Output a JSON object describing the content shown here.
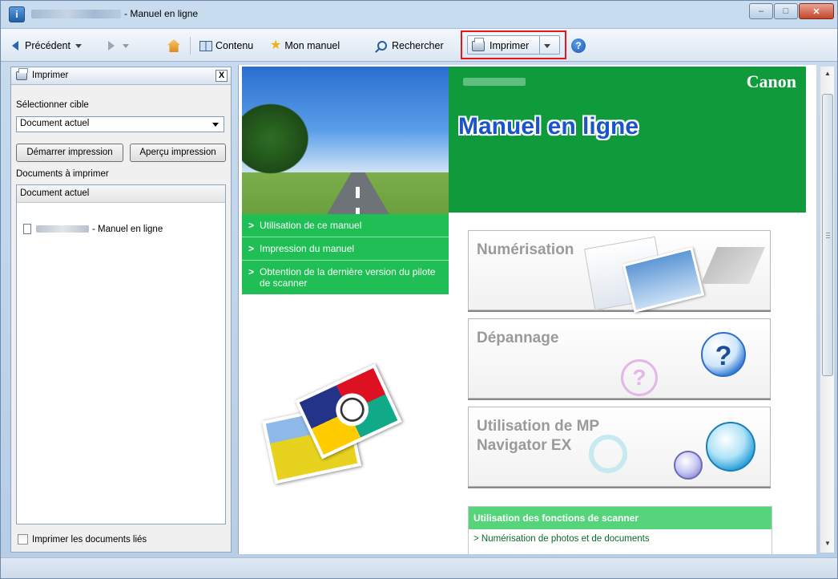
{
  "window": {
    "title_suffix": "- Manuel en ligne",
    "minimize_label": "–",
    "maximize_label": "□",
    "close_label": "✕"
  },
  "toolbar": {
    "back_label": "Précédent",
    "contents_label": "Contenu",
    "my_manual_label": "Mon manuel",
    "search_label": "Rechercher",
    "print_label": "Imprimer",
    "help_label": "?"
  },
  "print_pane": {
    "title": "Imprimer",
    "close_label": "X",
    "select_target_label": "Sélectionner cible",
    "target_value": "Document actuel",
    "start_print_label": "Démarrer impression",
    "print_preview_label": "Aperçu impression",
    "docs_to_print_label": "Documents à imprimer",
    "list_header": "Document actuel",
    "list_item_suffix": "- Manuel en ligne",
    "print_linked_label": "Imprimer les documents liés"
  },
  "content": {
    "brand": "Canon",
    "title": "Manuel en ligne",
    "links": [
      "Utilisation de ce manuel",
      "Impression du manuel",
      "Obtention de la dernière version du pilote de scanner"
    ],
    "cards": [
      "Numérisation",
      "Dépannage",
      "Utilisation de MP Navigator EX"
    ],
    "functions_header": "Utilisation des fonctions de scanner",
    "functions_link": "Numérisation de photos et de documents"
  },
  "colors": {
    "accent_red": "#e0191f",
    "canon_green": "#0f9a3c",
    "link_green": "#1fbf55",
    "title_blue": "#1a55c8"
  }
}
